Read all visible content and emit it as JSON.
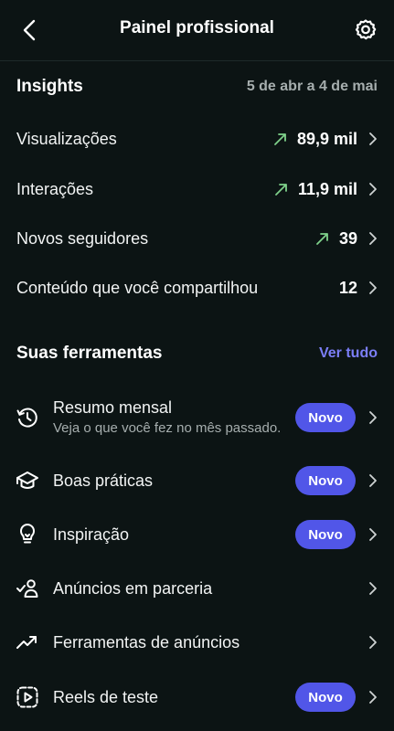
{
  "header": {
    "title": "Painel profissional"
  },
  "insights": {
    "title": "Insights",
    "date_range": "5 de abr a 4 de mai",
    "metrics": [
      {
        "label": "Visualizações",
        "value": "89,9 mil",
        "trend": "up"
      },
      {
        "label": "Interações",
        "value": "11,9 mil",
        "trend": "up"
      },
      {
        "label": "Novos seguidores",
        "value": "39",
        "trend": "up"
      },
      {
        "label": "Conteúdo que você compartilhou",
        "value": "12",
        "trend": "none"
      }
    ]
  },
  "tools": {
    "title": "Suas ferramentas",
    "see_all": "Ver tudo",
    "items": [
      {
        "name": "Resumo mensal",
        "subtitle": "Veja o que você fez no mês passado.",
        "badge": "Novo",
        "icon": "history-icon"
      },
      {
        "name": "Boas práticas",
        "badge": "Novo",
        "icon": "graduation-cap-icon"
      },
      {
        "name": "Inspiração",
        "badge": "Novo",
        "icon": "lightbulb-icon"
      },
      {
        "name": "Anúncios em parceria",
        "icon": "partnership-icon"
      },
      {
        "name": "Ferramentas de anúncios",
        "icon": "trending-icon"
      },
      {
        "name": "Reels de teste",
        "badge": "Novo",
        "icon": "reels-icon"
      }
    ]
  },
  "colors": {
    "background": "#0c1414",
    "accent": "#5156e8",
    "link": "#7b7ef7",
    "trend_up": "#7fd18b",
    "muted": "#a6aeae"
  }
}
